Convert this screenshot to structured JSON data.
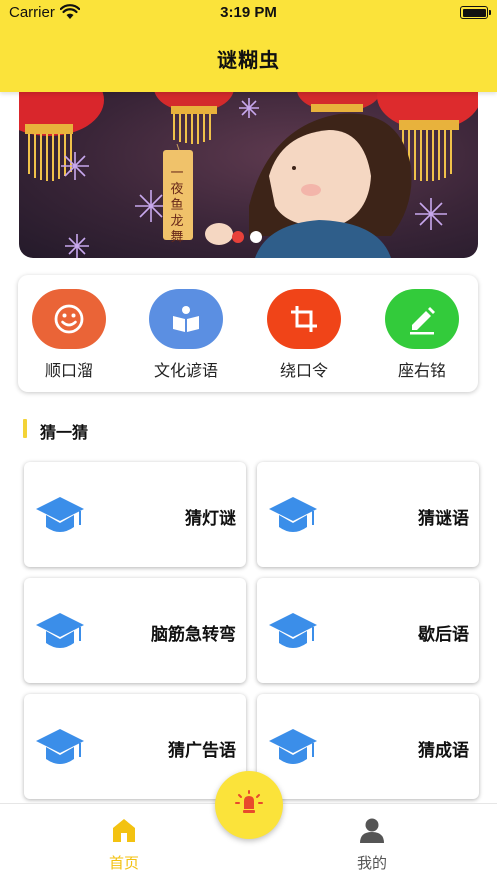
{
  "status_bar": {
    "carrier": "Carrier",
    "time": "3:19 PM"
  },
  "header": {
    "title": "谜糊虫"
  },
  "banner": {
    "page_index": 1,
    "page_count": 2,
    "lantern_text": "一夜鱼龙舞"
  },
  "categories": [
    {
      "label": "顺口溜",
      "icon": "smiley-icon",
      "color": "#ea6437"
    },
    {
      "label": "文化谚语",
      "icon": "book-icon",
      "color": "#5b8fe2"
    },
    {
      "label": "绕口令",
      "icon": "crop-icon",
      "color": "#f04418"
    },
    {
      "label": "座右铭",
      "icon": "pencil-icon",
      "color": "#33cb3b"
    }
  ],
  "section": {
    "title": "猜一猜"
  },
  "grid": [
    {
      "label": "猜灯谜",
      "icon": "graduation-cap-icon"
    },
    {
      "label": "猜谜语",
      "icon": "graduation-cap-icon"
    },
    {
      "label": "脑筋急转弯",
      "icon": "graduation-cap-icon"
    },
    {
      "label": "歇后语",
      "icon": "graduation-cap-icon"
    },
    {
      "label": "猜广告语",
      "icon": "graduation-cap-icon"
    },
    {
      "label": "猜成语",
      "icon": "graduation-cap-icon"
    }
  ],
  "tabbar": {
    "home": {
      "label": "首页",
      "icon": "home-icon",
      "active": true
    },
    "center": {
      "icon": "lightbulb-icon"
    },
    "mine": {
      "label": "我的",
      "icon": "person-icon",
      "active": false
    }
  },
  "colors": {
    "accent": "#fbe33a",
    "active_tab": "#f3c211",
    "inactive_tab": "#555555",
    "cap_blue": "#3b8ee9"
  }
}
